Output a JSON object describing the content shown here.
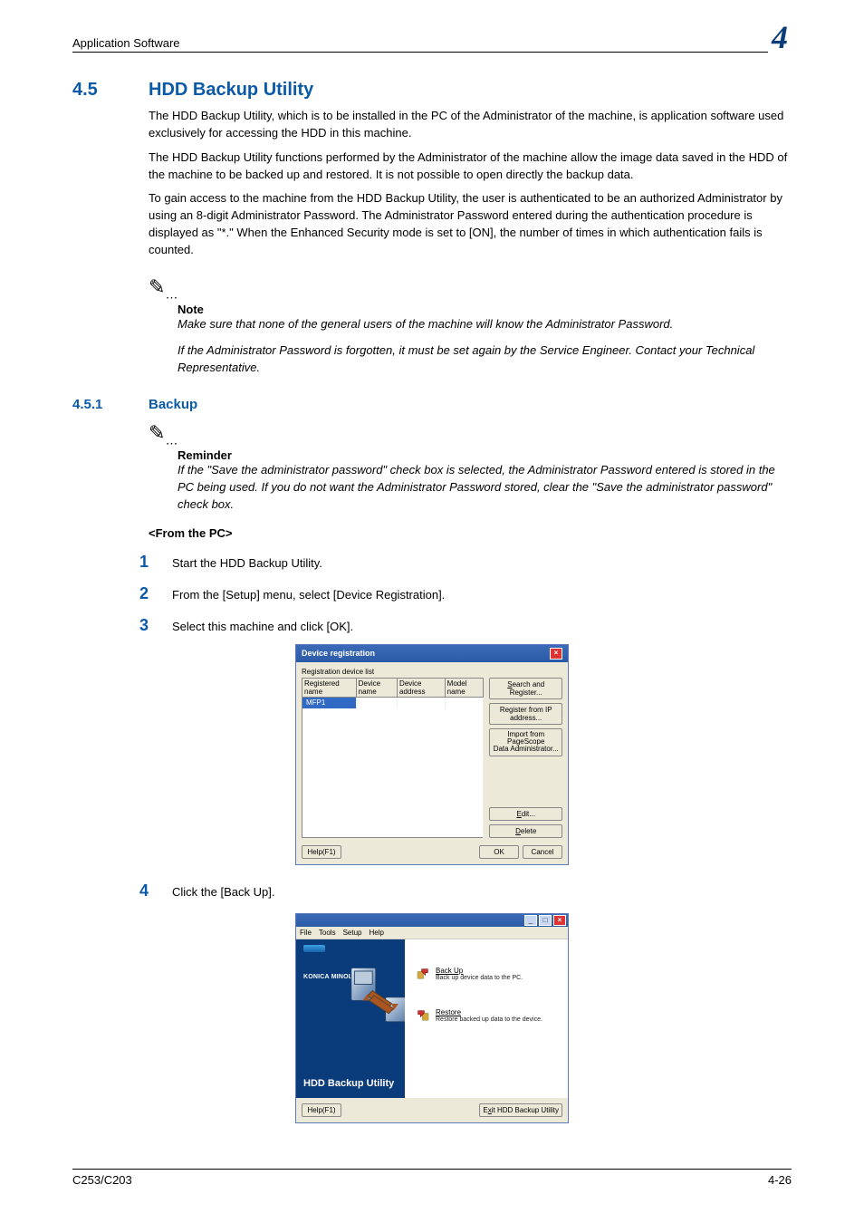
{
  "header": {
    "running_head": "Application Software",
    "chapter_number": "4"
  },
  "section": {
    "number": "4.5",
    "title": "HDD Backup Utility",
    "para1": "The HDD Backup Utility, which is to be installed in the PC of the Administrator of the machine, is application software used exclusively for accessing the HDD in this machine.",
    "para2": "The HDD Backup Utility functions performed by the Administrator of the machine allow the image data saved in the HDD of the machine to be backed up and restored. It is not possible to open directly the backup data.",
    "para3": "To gain access to the machine from the HDD Backup Utility, the user is authenticated to be an authorized Administrator by using an 8-digit Administrator Password. The Administrator Password entered during the authentication procedure is displayed as \"*.\" When the Enhanced Security mode is set to [ON], the number of times in which authentication fails is counted."
  },
  "note": {
    "label": "Note",
    "line1": "Make sure that none of the general users of the machine will know the Administrator Password.",
    "line2": "If the Administrator Password is forgotten, it must be set again by the Service Engineer. Contact your Technical Representative."
  },
  "subsection": {
    "number": "4.5.1",
    "title": "Backup"
  },
  "reminder": {
    "label": "Reminder",
    "body": "If the \"Save the administrator password\" check box is selected, the Administrator Password entered is stored in the PC being used. If you do not want the Administrator Password stored, clear the \"Save the administrator password\" check box."
  },
  "procedure": {
    "label": "<From the PC>",
    "steps": [
      {
        "n": "1",
        "text": "Start the HDD Backup Utility."
      },
      {
        "n": "2",
        "text": "From the [Setup] menu, select [Device Registration]."
      },
      {
        "n": "3",
        "text": "Select this machine and click [OK]."
      },
      {
        "n": "4",
        "text": "Click the [Back Up]."
      }
    ]
  },
  "dialog1": {
    "title": "Device registration",
    "group_label": "Registration device list",
    "columns": [
      "Registered name",
      "Device name",
      "Device address",
      "Model name"
    ],
    "selected_row": "MFP1",
    "buttons": {
      "search": "Search and Register...",
      "register_ip": "Register from IP address...",
      "import": "Import from\nPageScope\nData Administrator...",
      "edit": "Edit...",
      "delete": "Delete",
      "help": "Help(F1)",
      "ok": "OK",
      "cancel": "Cancel"
    }
  },
  "dialog2": {
    "menu": [
      "File",
      "Tools",
      "Setup",
      "Help"
    ],
    "brand": "KONICA MINOLTA",
    "product": "HDD Backup Utility",
    "backup": {
      "title": "Back Up",
      "desc": "Back up device data to the PC."
    },
    "restore": {
      "title": "Restore",
      "desc": "Restore backed up data to the device."
    },
    "help": "Help(F1)",
    "exit": "Exit HDD Backup Utility"
  },
  "footer": {
    "left": "C253/C203",
    "right": "4-26"
  }
}
